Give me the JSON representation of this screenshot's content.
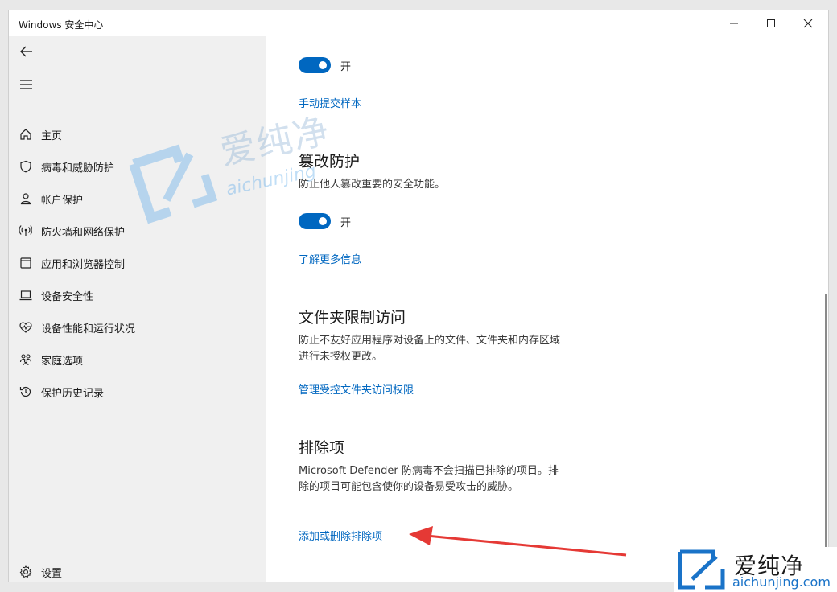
{
  "window": {
    "title": "Windows 安全中心"
  },
  "sidebar": {
    "items": [
      {
        "label": "主页",
        "icon": "home-icon"
      },
      {
        "label": "病毒和威胁防护",
        "icon": "shield-icon"
      },
      {
        "label": "帐户保护",
        "icon": "person-icon"
      },
      {
        "label": "防火墙和网络保护",
        "icon": "antenna-icon"
      },
      {
        "label": "应用和浏览器控制",
        "icon": "app-window-icon"
      },
      {
        "label": "设备安全性",
        "icon": "laptop-icon"
      },
      {
        "label": "设备性能和运行状况",
        "icon": "heart-pulse-icon"
      },
      {
        "label": "家庭选项",
        "icon": "family-icon"
      },
      {
        "label": "保护历史记录",
        "icon": "history-icon"
      }
    ],
    "settings_label": "设置"
  },
  "main": {
    "cloud_toggle_state": "开",
    "submit_sample_link": "手动提交样本",
    "tamper": {
      "heading": "篡改防护",
      "description": "防止他人篡改重要的安全功能。",
      "toggle_state": "开",
      "learn_more_link": "了解更多信息"
    },
    "folder_access": {
      "heading": "文件夹限制访问",
      "description": "防止不友好应用程序对设备上的文件、文件夹和内存区域进行未授权更改。",
      "manage_link": "管理受控文件夹访问权限"
    },
    "exclusions": {
      "heading": "排除项",
      "description": "Microsoft Defender 防病毒不会扫描已排除的项目。排除的项目可能包含使你的设备易受攻击的威胁。",
      "add_remove_link": "添加或删除排除项"
    }
  },
  "watermark": {
    "cn": "爱纯净",
    "en": "aichunjing.com",
    "mid_en": "aichunjing"
  },
  "colors": {
    "accent": "#0067c0",
    "sidebar_bg": "#f0f0f0",
    "arrow": "#e53935"
  }
}
